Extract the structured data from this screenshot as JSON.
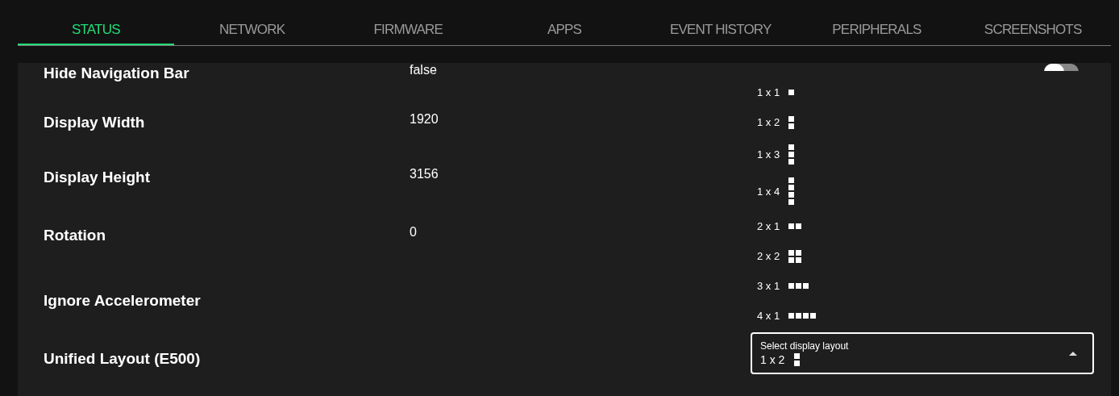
{
  "tabs": [
    {
      "label": "STATUS",
      "selected": true
    },
    {
      "label": "NETWORK",
      "selected": false
    },
    {
      "label": "FIRMWARE",
      "selected": false
    },
    {
      "label": "APPS",
      "selected": false
    },
    {
      "label": "EVENT HISTORY",
      "selected": false
    },
    {
      "label": "PERIPHERALS",
      "selected": false
    },
    {
      "label": "SCREENSHOTS",
      "selected": false
    }
  ],
  "settings": [
    {
      "label": "Hide Navigation Bar",
      "value": "false"
    },
    {
      "label": "Display Width",
      "value": "1920"
    },
    {
      "label": "Display Height",
      "value": "3156"
    },
    {
      "label": "Rotation",
      "value": "0"
    },
    {
      "label": "Ignore Accelerometer"
    },
    {
      "label": "Unified Layout (E500)"
    }
  ],
  "toggle": {
    "on": false
  },
  "layout_menu": {
    "options": [
      {
        "label": "1 x 1",
        "kind": "single"
      },
      {
        "label": "1 x 2",
        "kind": "column2"
      },
      {
        "label": "1 x 3",
        "kind": "column3"
      },
      {
        "label": "1 x 4",
        "kind": "column4"
      },
      {
        "label": "2 x 1",
        "kind": "row2"
      },
      {
        "label": "2 x 2",
        "kind": "quad"
      },
      {
        "label": "3 x 1",
        "kind": "row3"
      },
      {
        "label": "4 x 1",
        "kind": "row4"
      }
    ]
  },
  "layout_select": {
    "label": "Select display layout",
    "value": "1 x 2",
    "kind": "column2",
    "expanded": true
  }
}
